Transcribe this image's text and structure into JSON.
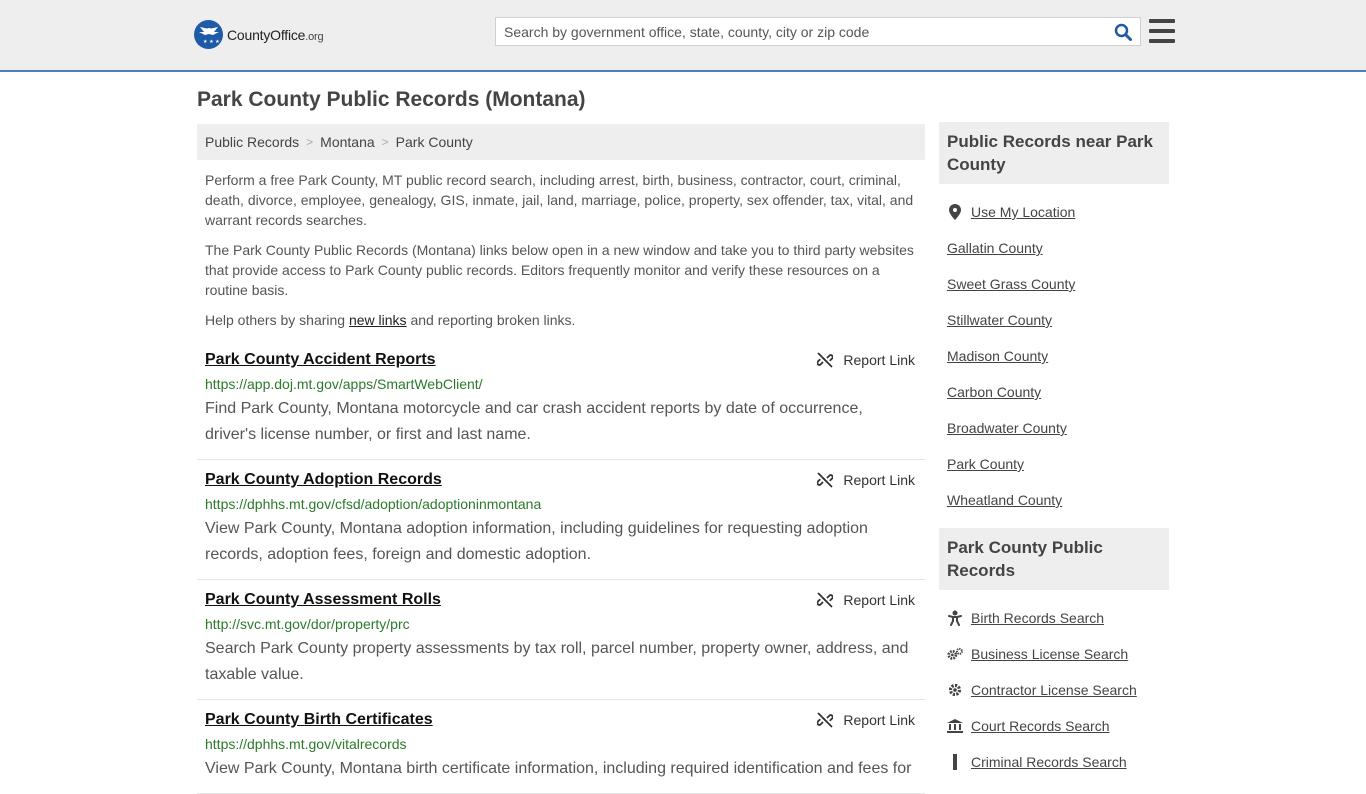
{
  "header": {
    "logo_name": "CountyOffice",
    "logo_tld": ".org",
    "search_placeholder": "Search by government office, state, county, city or zip code"
  },
  "page_title": "Park County Public Records (Montana)",
  "breadcrumb": [
    "Public Records",
    "Montana",
    "Park County"
  ],
  "intro": {
    "p1": "Perform a free Park County, MT public record search, including arrest, birth, business, contractor, court, criminal, death, divorce, employee, genealogy, GIS, inmate, jail, land, marriage, police, property, sex offender, tax, vital, and warrant records searches.",
    "p2": "The Park County Public Records (Montana) links below open in a new window and take you to third party websites that provide access to Park County public records. Editors frequently monitor and verify these resources on a routine basis.",
    "p3_before": "Help others by sharing ",
    "p3_link": "new links",
    "p3_after": " and reporting broken links."
  },
  "report_label": "Report Link",
  "records": [
    {
      "title": "Park County Accident Reports",
      "url": "https://app.doj.mt.gov/apps/SmartWebClient/",
      "desc": "Find Park County, Montana motorcycle and car crash accident reports by date of occurrence, driver's license number, or first and last name."
    },
    {
      "title": "Park County Adoption Records",
      "url": "https://dphhs.mt.gov/cfsd/adoption/adoptioninmontana",
      "desc": "View Park County, Montana adoption information, including guidelines for requesting adoption records, adoption fees, foreign and domestic adoption."
    },
    {
      "title": "Park County Assessment Rolls",
      "url": "http://svc.mt.gov/dor/property/prc",
      "desc": "Search Park County property assessments by tax roll, parcel number, property owner, address, and taxable value."
    },
    {
      "title": "Park County Birth Certificates",
      "url": "https://dphhs.mt.gov/vitalrecords",
      "desc": "View Park County, Montana birth certificate information, including required identification and fees for"
    }
  ],
  "sidebar": {
    "near_heading": "Public Records near Park County",
    "near_items": [
      {
        "label": "Use My Location",
        "icon": "location-pin-icon"
      },
      {
        "label": "Gallatin County"
      },
      {
        "label": "Sweet Grass County"
      },
      {
        "label": "Stillwater County"
      },
      {
        "label": "Madison County"
      },
      {
        "label": "Carbon County"
      },
      {
        "label": "Broadwater County"
      },
      {
        "label": "Park County"
      },
      {
        "label": "Wheatland County"
      }
    ],
    "records_heading": "Park County Public Records",
    "records_items": [
      {
        "label": "Birth Records Search",
        "icon": "baby-icon"
      },
      {
        "label": "Business License Search",
        "icon": "gears-icon"
      },
      {
        "label": "Contractor License Search",
        "icon": "gear-icon"
      },
      {
        "label": "Court Records Search",
        "icon": "courthouse-icon"
      },
      {
        "label": "Criminal Records Search",
        "icon": "handcuffs-icon"
      }
    ]
  },
  "colors": {
    "accent": "#1e5aa8",
    "url_green": "#2b7a2b",
    "header_bg": "#eeeeee"
  }
}
